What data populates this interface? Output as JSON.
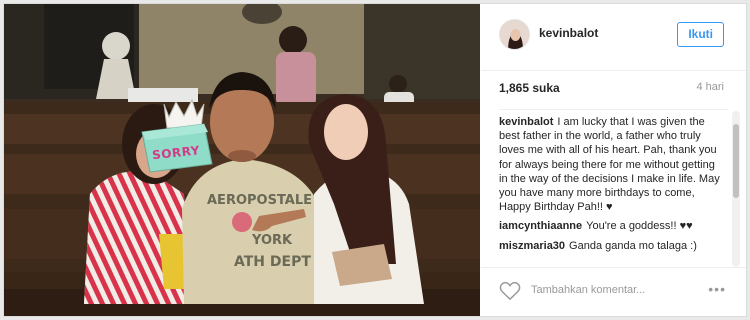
{
  "post": {
    "photo_sticker": "SORRY",
    "shirt_print": [
      "AEROPOSTALE",
      "YORK",
      "ATH DEPT"
    ]
  },
  "header": {
    "username": "kevinbalot",
    "follow_label": "Ikuti"
  },
  "stats": {
    "likes": "1,865 suka",
    "time": "4 hari"
  },
  "comments": [
    {
      "author": "kevinbalot",
      "text": "I am lucky that I was given the best father in the world, a father who truly loves me with all of his heart. Pah, thank you for always being there for me without getting in the way of the decisions I make in life. May you have many more birthdays to come, Happy Birthday Pah!! ♥"
    },
    {
      "author": "iamcynthiaanne",
      "text": "You're a goddess!! ♥♥"
    },
    {
      "author": "miszmaria30",
      "text": "Ganda ganda mo talaga :)"
    }
  ],
  "footer": {
    "comment_placeholder": "Tambahkan komentar...",
    "more_label": "•••"
  },
  "colors": {
    "accent": "#3897f0",
    "text": "#262626",
    "muted": "#999999"
  },
  "icons": {
    "like": "heart-icon",
    "more": "more-options-icon"
  }
}
